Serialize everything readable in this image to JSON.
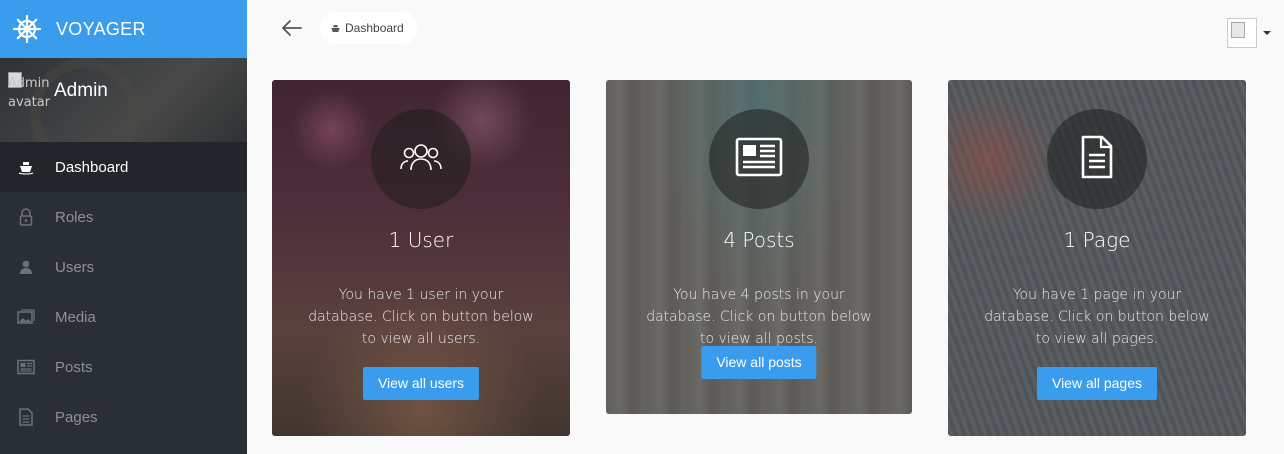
{
  "brand": {
    "title": "VOYAGER",
    "color": "#3a9ced"
  },
  "profile": {
    "name": "Admin",
    "avatar_alt": "Admin avatar"
  },
  "sidebar": {
    "items": [
      {
        "label": "Dashboard",
        "icon": "boat-icon",
        "active": true
      },
      {
        "label": "Roles",
        "icon": "lock-icon",
        "active": false
      },
      {
        "label": "Users",
        "icon": "person-icon",
        "active": false
      },
      {
        "label": "Media",
        "icon": "images-icon",
        "active": false
      },
      {
        "label": "Posts",
        "icon": "news-icon",
        "active": false
      },
      {
        "label": "Pages",
        "icon": "file-icon",
        "active": false
      }
    ]
  },
  "topbar": {
    "breadcrumb": "Dashboard"
  },
  "cards": [
    {
      "title": "1 User",
      "description": "You have 1 user in your database. Click on button below to view all users.",
      "button": "View all users",
      "icon": "people-icon"
    },
    {
      "title": "4 Posts",
      "description": "You have 4 posts in your database. Click on button below to view all posts.",
      "button": "View all posts",
      "icon": "newspaper-icon"
    },
    {
      "title": "1 Page",
      "description": "You have 1 page in your database. Click on button below to view all pages.",
      "button": "View all pages",
      "icon": "document-icon"
    }
  ]
}
